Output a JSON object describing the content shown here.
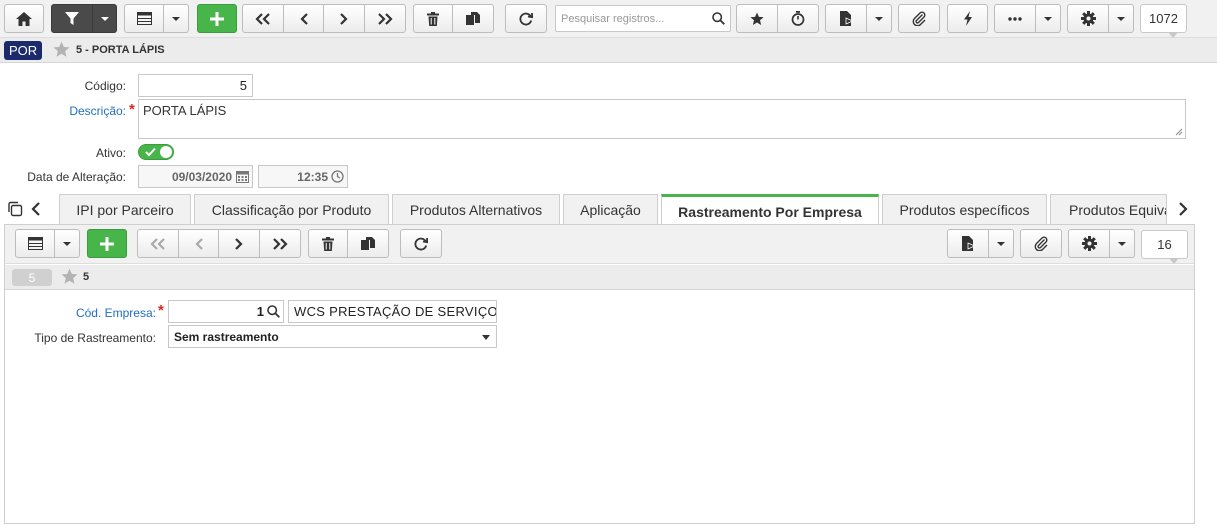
{
  "toolbar": {
    "search_placeholder": "Pesquisar registros...",
    "record_count": "1072"
  },
  "header": {
    "module_badge": "POR",
    "title": "5 - PORTA LÁPIS"
  },
  "form": {
    "codigo_label": "Código:",
    "codigo_value": "5",
    "descricao_label": "Descrição:",
    "descricao_value": "PORTA LÁPIS",
    "ativo_label": "Ativo:",
    "ativo_value": true,
    "data_alteracao_label": "Data de Alteração:",
    "data_alteracao_date": "09/03/2020",
    "data_alteracao_time": "12:35"
  },
  "tabs": [
    {
      "label": "IPI por Parceiro"
    },
    {
      "label": "Classificação por Produto"
    },
    {
      "label": "Produtos Alternativos"
    },
    {
      "label": "Aplicação"
    },
    {
      "label": "Rastreamento Por Empresa",
      "active": true
    },
    {
      "label": "Produtos específicos"
    },
    {
      "label": "Produtos Equiva"
    }
  ],
  "subform": {
    "record_count": "16",
    "badge": "5",
    "title": "5",
    "cod_empresa_label": "Cód. Empresa:",
    "cod_empresa_value": "1",
    "empresa_nome": "WCS PRESTAÇÃO DE SERVIÇOS",
    "tipo_rastreamento_label": "Tipo de Rastreamento:",
    "tipo_rastreamento_value": "Sem rastreamento"
  },
  "colors": {
    "accent_green": "#47b54a",
    "badge_navy": "#1b2a6b",
    "link_blue": "#1f6fc1",
    "required_red": "#d9261c"
  }
}
